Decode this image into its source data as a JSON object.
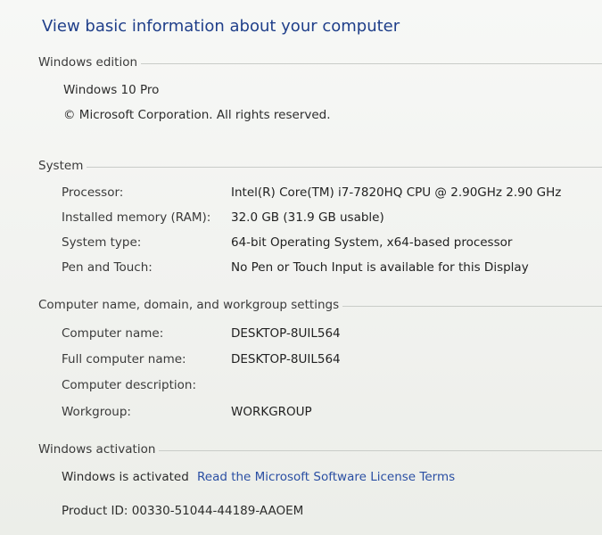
{
  "title": "View basic information about your computer",
  "windows_edition": {
    "header": "Windows edition",
    "edition": "Windows 10 Pro",
    "copyright": "© Microsoft Corporation. All rights reserved."
  },
  "system": {
    "header": "System",
    "rows": [
      {
        "label": "Processor:",
        "value": "Intel(R) Core(TM) i7-7820HQ CPU @ 2.90GHz   2.90 GHz"
      },
      {
        "label": "Installed memory (RAM):",
        "value": "32.0 GB (31.9 GB usable)"
      },
      {
        "label": "System type:",
        "value": "64-bit Operating System, x64-based processor"
      },
      {
        "label": "Pen and Touch:",
        "value": "No Pen or Touch Input is available for this Display"
      }
    ]
  },
  "computer_name": {
    "header": "Computer name, domain, and workgroup settings",
    "rows": [
      {
        "label": "Computer name:",
        "value": "DESKTOP-8UIL564"
      },
      {
        "label": "Full computer name:",
        "value": "DESKTOP-8UIL564"
      },
      {
        "label": "Computer description:",
        "value": ""
      },
      {
        "label": "Workgroup:",
        "value": "WORKGROUP"
      }
    ]
  },
  "activation": {
    "header": "Windows activation",
    "status": "Windows is activated",
    "license_link": "Read the Microsoft Software License Terms",
    "product_id": "Product ID: 00330-51044-44189-AAOEM"
  }
}
